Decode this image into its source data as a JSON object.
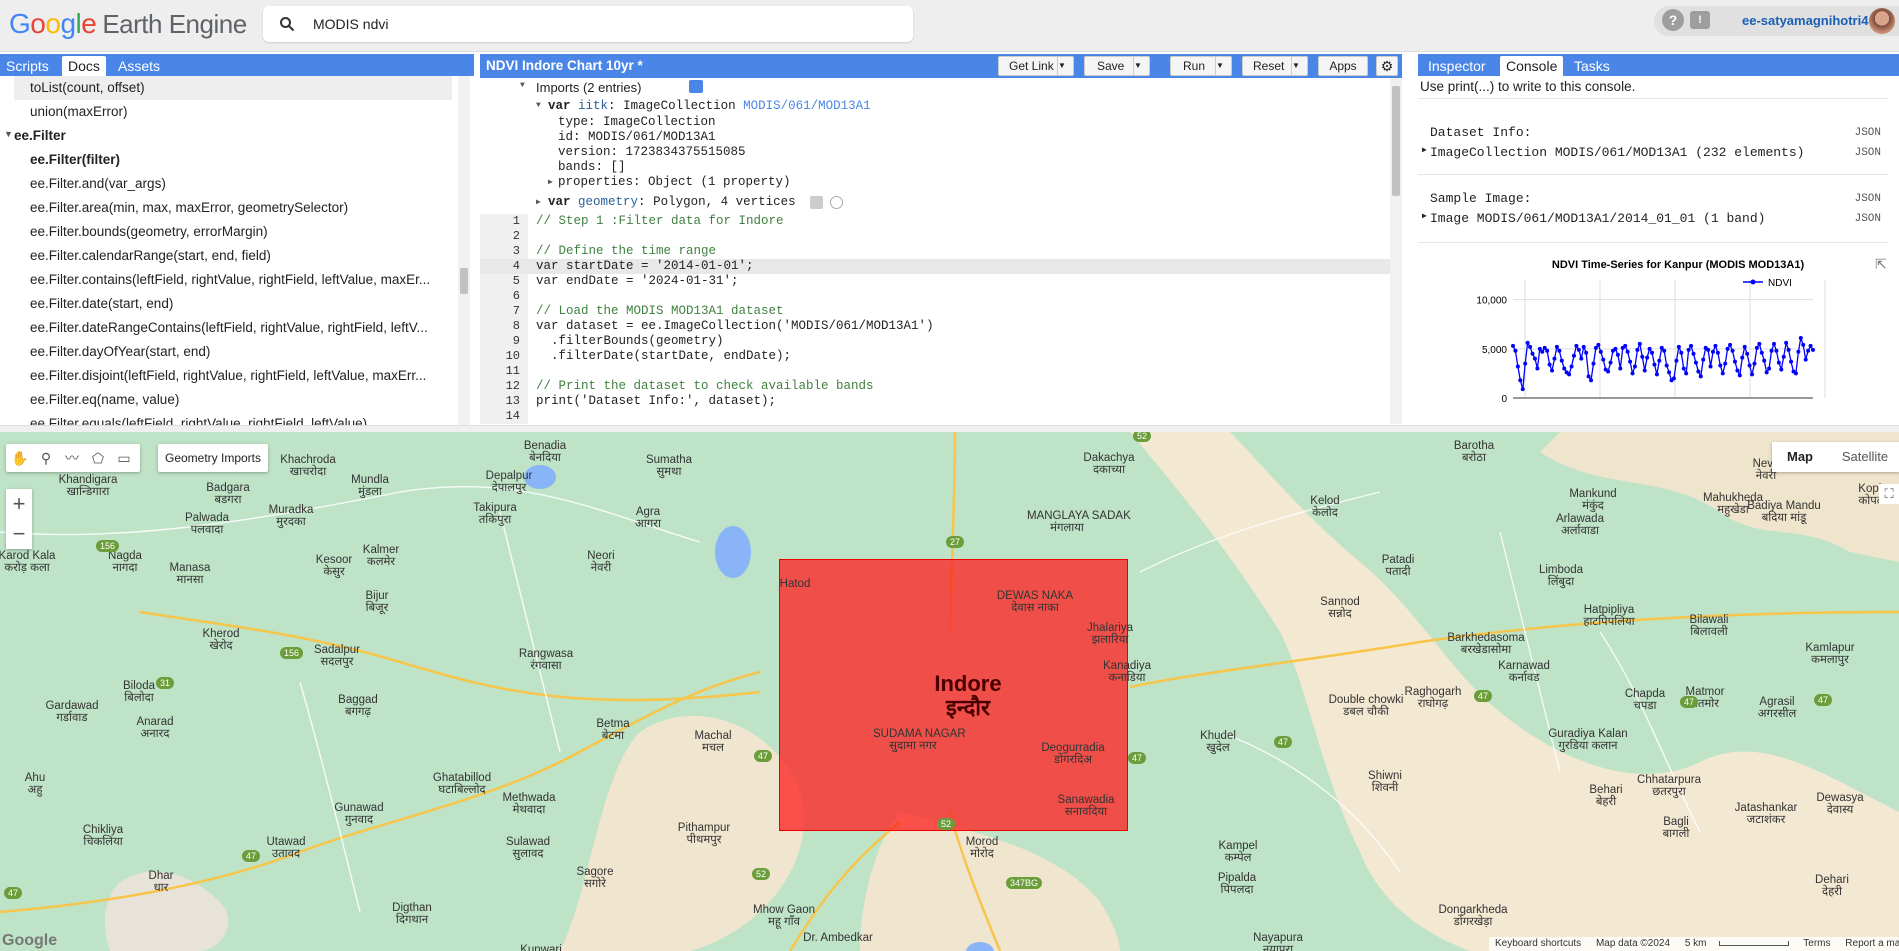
{
  "header": {
    "logo_google": [
      "G",
      "o",
      "o",
      "g",
      "l",
      "e"
    ],
    "logo_product": "Earth Engine",
    "search_value": "MODIS ndvi",
    "user_name": "ee-satyamagnihotri4"
  },
  "left_panel": {
    "tabs": [
      {
        "label": "Scripts"
      },
      {
        "label": "Docs"
      },
      {
        "label": "Assets"
      }
    ],
    "items": [
      {
        "text": "toList(count, offset)",
        "kind": "method"
      },
      {
        "text": "union(maxError)",
        "kind": "method"
      },
      {
        "text": "ee.Filter",
        "kind": "group"
      },
      {
        "text": "ee.Filter(filter)",
        "kind": "ctor"
      },
      {
        "text": "ee.Filter.and(var_args)",
        "kind": "fn"
      },
      {
        "text": "ee.Filter.area(min, max, maxError, geometrySelector)",
        "kind": "fn"
      },
      {
        "text": "ee.Filter.bounds(geometry, errorMargin)",
        "kind": "fn"
      },
      {
        "text": "ee.Filter.calendarRange(start, end, field)",
        "kind": "fn"
      },
      {
        "text": "ee.Filter.contains(leftField, rightValue, rightField, leftValue, maxEr...",
        "kind": "fn"
      },
      {
        "text": "ee.Filter.date(start, end)",
        "kind": "fn"
      },
      {
        "text": "ee.Filter.dateRangeContains(leftField, rightValue, rightField, leftV...",
        "kind": "fn"
      },
      {
        "text": "ee.Filter.dayOfYear(start, end)",
        "kind": "fn"
      },
      {
        "text": "ee.Filter.disjoint(leftField, rightValue, rightField, leftValue, maxErr...",
        "kind": "fn"
      },
      {
        "text": "ee.Filter.eq(name, value)",
        "kind": "fn"
      },
      {
        "text": "ee.Filter.equals(leftField, rightValue, rightField, leftValue)",
        "kind": "fn"
      }
    ]
  },
  "editor": {
    "title": "NDVI Indore Chart 10yr *",
    "buttons": {
      "get_link": "Get Link",
      "save": "Save",
      "run": "Run",
      "reset": "Reset",
      "apps": "Apps"
    },
    "imports": {
      "header": "Imports (2 entries)",
      "var1_name": "iitk",
      "var1_type": "ImageCollection",
      "var1_link": "MODIS/061/MOD13A1",
      "type": "type: ImageCollection",
      "id": "id: MODIS/061/MOD13A1",
      "version": "version: 1723834375515085",
      "bands": "bands: []",
      "properties": "properties: Object (1 property)",
      "var2_name": "geometry",
      "var2_desc": "Polygon, 4 vertices"
    },
    "lines": [
      "// Step 1 :Filter data for Indore",
      "",
      "// Define the time range",
      "var startDate = '2014-01-01';",
      "var endDate = '2024-01-31';",
      "",
      "// Load the MODIS MOD13A1 dataset",
      "var dataset = ee.ImageCollection('MODIS/061/MOD13A1')",
      "  .filterBounds(geometry)",
      "  .filterDate(startDate, endDate);",
      "",
      "// Print the dataset to check available bands",
      "print('Dataset Info:', dataset);",
      ""
    ]
  },
  "right_panel": {
    "tabs": [
      {
        "label": "Inspector"
      },
      {
        "label": "Console"
      },
      {
        "label": "Tasks"
      }
    ],
    "hint": "Use print(...) to write to this console.",
    "dataset_label": "Dataset Info:",
    "dataset_value": "ImageCollection MODIS/061/MOD13A1 (232 elements)",
    "sample_label": "Sample Image:",
    "sample_value": "Image MODIS/061/MOD13A1/2014_01_01 (1 band)",
    "json": "JSON"
  },
  "chart_data": {
    "type": "line",
    "title": "NDVI Time-Series for Kanpur (MODIS MOD13A1)",
    "legend": "top-right",
    "series": [
      {
        "name": "NDVI",
        "color": "#0000ff",
        "values": [
          5300,
          4800,
          3200,
          1800,
          900,
          3500,
          5600,
          5200,
          4500,
          4000,
          3000,
          5000,
          4700,
          5100,
          4800,
          3400,
          2800,
          4000,
          5200,
          4800,
          3800,
          3000,
          2600,
          2400,
          3200,
          4300,
          5300,
          4900,
          4000,
          5200,
          4600,
          2200,
          1800,
          3500,
          5100,
          5400,
          4700,
          3900,
          2900,
          2700,
          3600,
          4800,
          5000,
          4400,
          3000,
          5100,
          5300,
          4700,
          3700,
          2500,
          3200,
          4900,
          5500,
          4200,
          2800,
          4100,
          5000,
          4600,
          3400,
          2400,
          3800,
          5100,
          4800,
          3300,
          2600,
          1800,
          2000,
          3800,
          5200,
          4600,
          3000,
          2500,
          4900,
          5300,
          4500,
          3600,
          2700,
          2200,
          3900,
          5100,
          4900,
          3200,
          4700,
          5300,
          4600,
          3300,
          2500,
          3500,
          5000,
          5400,
          4800,
          3700,
          2800,
          2300,
          4100,
          5200,
          4500,
          3300,
          2400,
          3500,
          5100,
          5500,
          4600,
          3800,
          2600,
          3000,
          4800,
          5500,
          4800,
          3600,
          2900,
          4200,
          5600,
          4900,
          3700,
          2700,
          2500,
          4700,
          6100,
          5400,
          3900,
          4800,
          5300,
          4900
        ]
      }
    ],
    "ylim": [
      0,
      12000
    ],
    "yticks": [
      "10,000",
      "5,000",
      "0"
    ]
  },
  "map": {
    "toolbar_label": "Geometry Imports",
    "map_button": "Map",
    "satellite_button": "Satellite",
    "polygon_color": "#ff1e1e",
    "labels": [
      {
        "name": "Indore",
        "hindi": "इन्दौर",
        "x": 968,
        "y": 240,
        "big": true
      },
      {
        "name": "SUDAMA NAGAR",
        "hindi": "सुदामा नगर",
        "x": 913,
        "y": 296
      },
      {
        "name": "Benadia",
        "hindi": "बेनदिया",
        "x": 545,
        "y": 8
      },
      {
        "name": "Sumatha",
        "hindi": "सुमथा",
        "x": 669,
        "y": 22
      },
      {
        "name": "Dakachya",
        "hindi": "दकाच्या",
        "x": 1109,
        "y": 20
      },
      {
        "name": "Barotha",
        "hindi": "बरोठा",
        "x": 1474,
        "y": 8
      },
      {
        "name": "Khachroda",
        "hindi": "खाचरोदा",
        "x": 308,
        "y": 22
      },
      {
        "name": "Mundla",
        "hindi": "मुंडला",
        "x": 370,
        "y": 42
      },
      {
        "name": "Depalpur",
        "hindi": "देपालपुर",
        "x": 509,
        "y": 38
      },
      {
        "name": "Khandigara",
        "hindi": "खान्डिगारा",
        "x": 88,
        "y": 42
      },
      {
        "name": "Badgara",
        "hindi": "बडगरा",
        "x": 228,
        "y": 50
      },
      {
        "name": "Takipura",
        "hindi": "तकिपुरा",
        "x": 495,
        "y": 70
      },
      {
        "name": "Agra",
        "hindi": "आगरा",
        "x": 648,
        "y": 74
      },
      {
        "name": "Muradka",
        "hindi": "मुरदका",
        "x": 291,
        "y": 72
      },
      {
        "name": "Palwada",
        "hindi": "पलवादा",
        "x": 207,
        "y": 80
      },
      {
        "name": "Kelod",
        "hindi": "केलोद",
        "x": 1325,
        "y": 63
      },
      {
        "name": "Mahukheda",
        "hindi": "महुखेडा",
        "x": 1733,
        "y": 60
      },
      {
        "name": "Mankund",
        "hindi": "मंकुंद",
        "x": 1593,
        "y": 56
      },
      {
        "name": "Arlawada",
        "hindi": "अर्लावाडा",
        "x": 1580,
        "y": 81
      },
      {
        "name": "Badiya Mandu",
        "hindi": "बदिया मांडू",
        "x": 1784,
        "y": 68
      },
      {
        "name": "Kopla",
        "hindi": "कोपला",
        "x": 1873,
        "y": 51
      },
      {
        "name": "Nevri",
        "hindi": "नेवरी",
        "x": 1766,
        "y": 26
      },
      {
        "name": "MANGLAYA SADAK",
        "hindi": "मंगलाया",
        "x": 1067,
        "y": 78
      },
      {
        "name": "Karod Kala",
        "hindi": "करोड़ कला",
        "x": 27,
        "y": 118
      },
      {
        "name": "Nagda",
        "hindi": "नागदा",
        "x": 125,
        "y": 118
      },
      {
        "name": "Manasa",
        "hindi": "मानसा",
        "x": 190,
        "y": 130
      },
      {
        "name": "Kalmer",
        "hindi": "कलमेर",
        "x": 381,
        "y": 112
      },
      {
        "name": "Kesoor",
        "hindi": "केसुर",
        "x": 334,
        "y": 122
      },
      {
        "name": "Neori",
        "hindi": "नेवरी",
        "x": 601,
        "y": 118
      },
      {
        "name": "Hatod",
        "hindi": "",
        "x": 795,
        "y": 146
      },
      {
        "name": "DEWAS NAKA",
        "hindi": "देवास नाका",
        "x": 1035,
        "y": 158
      },
      {
        "name": "Jhalariya",
        "hindi": "झलारिया",
        "x": 1110,
        "y": 190
      },
      {
        "name": "Patadi",
        "hindi": "पतादी",
        "x": 1398,
        "y": 122
      },
      {
        "name": "Sannod",
        "hindi": "सन्नोद",
        "x": 1340,
        "y": 164
      },
      {
        "name": "Limboda",
        "hindi": "लिंबुदा",
        "x": 1561,
        "y": 132
      },
      {
        "name": "Hatpipliya",
        "hindi": "हाटपिपलिया",
        "x": 1609,
        "y": 172
      },
      {
        "name": "Bilawali",
        "hindi": "बिलावली",
        "x": 1709,
        "y": 182
      },
      {
        "name": "Barkhedasoma",
        "hindi": "बरखेडासोमा",
        "x": 1486,
        "y": 200
      },
      {
        "name": "Kamlapur",
        "hindi": "कमलापुर",
        "x": 1830,
        "y": 210
      },
      {
        "name": "Bijur",
        "hindi": "बिजूर",
        "x": 377,
        "y": 158
      },
      {
        "name": "Kherod",
        "hindi": "खेरोद",
        "x": 221,
        "y": 196
      },
      {
        "name": "Sadalpur",
        "hindi": "सदलपुर",
        "x": 337,
        "y": 212
      },
      {
        "name": "Rangwasa",
        "hindi": "रंगवासा",
        "x": 546,
        "y": 216
      },
      {
        "name": "Kanadiya",
        "hindi": "कनाडिया",
        "x": 1127,
        "y": 228
      },
      {
        "name": "Karnawad",
        "hindi": "कर्नावड",
        "x": 1524,
        "y": 228
      },
      {
        "name": "Biloda",
        "hindi": "बिलोदा",
        "x": 139,
        "y": 248
      },
      {
        "name": "Gardawad",
        "hindi": "गर्डावाड",
        "x": 72,
        "y": 268
      },
      {
        "name": "Anarad",
        "hindi": "अनारद",
        "x": 155,
        "y": 284
      },
      {
        "name": "Baggad",
        "hindi": "बगगढ़",
        "x": 358,
        "y": 262
      },
      {
        "name": "Double chowki",
        "hindi": "डबल चौकी",
        "x": 1366,
        "y": 262
      },
      {
        "name": "Raghogarh",
        "hindi": "राघोगढ़",
        "x": 1433,
        "y": 254
      },
      {
        "name": "Chapda",
        "hindi": "चपडा",
        "x": 1645,
        "y": 256
      },
      {
        "name": "Matmor",
        "hindi": "मतमोर",
        "x": 1705,
        "y": 254
      },
      {
        "name": "Agrasil",
        "hindi": "अगरसील",
        "x": 1777,
        "y": 264
      },
      {
        "name": "Betma",
        "hindi": "बेटमा",
        "x": 613,
        "y": 286
      },
      {
        "name": "Machal",
        "hindi": "मचल",
        "x": 713,
        "y": 298
      },
      {
        "name": "Khudel",
        "hindi": "खुदेल",
        "x": 1218,
        "y": 298
      },
      {
        "name": "Guradiya Kalan",
        "hindi": "गुरडिया कलान",
        "x": 1588,
        "y": 296
      },
      {
        "name": "Deogurradia",
        "hindi": "डोंगरदिअ",
        "x": 1073,
        "y": 310
      },
      {
        "name": "Ahu",
        "hindi": "अहु",
        "x": 35,
        "y": 340
      },
      {
        "name": "Ghatabillod",
        "hindi": "घटाबिल्लोद",
        "x": 462,
        "y": 340
      },
      {
        "name": "Shiwni",
        "hindi": "शिवनी",
        "x": 1385,
        "y": 338
      },
      {
        "name": "Chhatarpura",
        "hindi": "छतरपुरा",
        "x": 1669,
        "y": 342
      },
      {
        "name": "Methwada",
        "hindi": "मेथवादा",
        "x": 529,
        "y": 360
      },
      {
        "name": "Gunawad",
        "hindi": "गुनवाद",
        "x": 359,
        "y": 370
      },
      {
        "name": "Behari",
        "hindi": "बेहरी",
        "x": 1606,
        "y": 352
      },
      {
        "name": "Jatashankar",
        "hindi": "जटाशंकर",
        "x": 1766,
        "y": 370
      },
      {
        "name": "Dewasya",
        "hindi": "देवास्य",
        "x": 1840,
        "y": 360
      },
      {
        "name": "Sanawadia",
        "hindi": "सनावदिया",
        "x": 1086,
        "y": 362
      },
      {
        "name": "Chikliya",
        "hindi": "चिकलिया",
        "x": 103,
        "y": 392
      },
      {
        "name": "Utawad",
        "hindi": "उतावद",
        "x": 286,
        "y": 404
      },
      {
        "name": "Sulawad",
        "hindi": "सुलावद",
        "x": 528,
        "y": 404
      },
      {
        "name": "Pithampur",
        "hindi": "पीथमपुर",
        "x": 704,
        "y": 390
      },
      {
        "name": "Morod",
        "hindi": "मोरोद",
        "x": 982,
        "y": 404
      },
      {
        "name": "Kampel",
        "hindi": "कम्पेल",
        "x": 1238,
        "y": 408
      },
      {
        "name": "Bagli",
        "hindi": "बागली",
        "x": 1676,
        "y": 384
      },
      {
        "name": "Dhar",
        "hindi": "धार",
        "x": 161,
        "y": 438
      },
      {
        "name": "Sagore",
        "hindi": "सगोरे",
        "x": 595,
        "y": 434
      },
      {
        "name": "Pipalda",
        "hindi": "पिपलदा",
        "x": 1237,
        "y": 440
      },
      {
        "name": "Dehari",
        "hindi": "देहरी",
        "x": 1832,
        "y": 442
      },
      {
        "name": "Digthan",
        "hindi": "दिगथान",
        "x": 412,
        "y": 470
      },
      {
        "name": "Mhow Gaon",
        "hindi": "महू गाँव",
        "x": 784,
        "y": 472
      },
      {
        "name": "Dongarkheda",
        "hindi": "डोंगरखेड़ा",
        "x": 1473,
        "y": 472
      },
      {
        "name": "Dr. Ambedkar",
        "hindi": "",
        "x": 838,
        "y": 500
      },
      {
        "name": "Nayapura",
        "hindi": "नयापुरा",
        "x": 1278,
        "y": 500
      },
      {
        "name": "Kunwari",
        "hindi": "",
        "x": 541,
        "y": 512
      }
    ],
    "footer": [
      "Keyboard shortcuts",
      "Map data ©2024",
      "5 km",
      "Terms",
      "Report a map error"
    ]
  }
}
